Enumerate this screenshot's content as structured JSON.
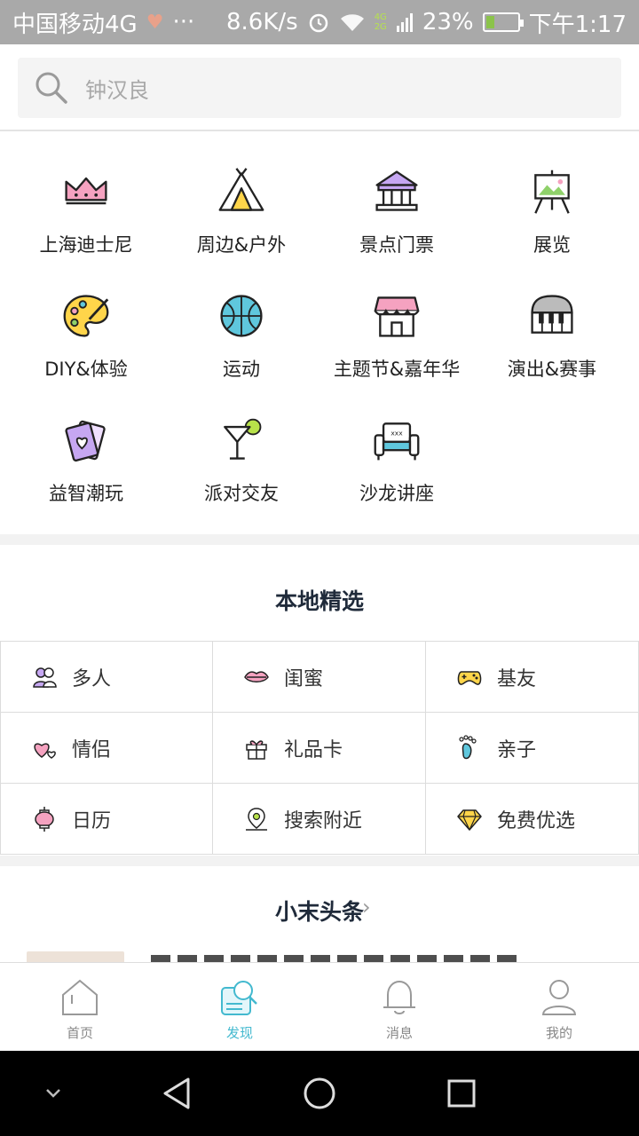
{
  "status_bar": {
    "carrier": "中国移动4G",
    "dots": "···",
    "speed": "8.6K/s",
    "net_4g": "4G",
    "net_2g": "2G",
    "battery_pct": "23%",
    "time": "下午1:17",
    "battery_level": 0.23
  },
  "search": {
    "placeholder": "钟汉良"
  },
  "categories": [
    {
      "label": "上海迪士尼",
      "icon": "crown-icon"
    },
    {
      "label": "周边&户外",
      "icon": "tent-icon"
    },
    {
      "label": "景点门票",
      "icon": "temple-icon"
    },
    {
      "label": "展览",
      "icon": "easel-icon"
    },
    {
      "label": "DIY&体验",
      "icon": "palette-icon"
    },
    {
      "label": "运动",
      "icon": "ball-icon"
    },
    {
      "label": "主题节&嘉年华",
      "icon": "stall-icon"
    },
    {
      "label": "演出&赛事",
      "icon": "piano-icon"
    },
    {
      "label": "益智潮玩",
      "icon": "cards-icon"
    },
    {
      "label": "派对交友",
      "icon": "cocktail-icon"
    },
    {
      "label": "沙龙讲座",
      "icon": "sofa-icon"
    }
  ],
  "local": {
    "title": "本地精选",
    "items": [
      {
        "label": "多人",
        "icon": "people-icon"
      },
      {
        "label": "闺蜜",
        "icon": "lips-icon"
      },
      {
        "label": "基友",
        "icon": "gamepad-icon"
      },
      {
        "label": "情侣",
        "icon": "hearts-icon"
      },
      {
        "label": "礼品卡",
        "icon": "gift-icon"
      },
      {
        "label": "亲子",
        "icon": "footprint-icon"
      },
      {
        "label": "日历",
        "icon": "lantern-icon"
      },
      {
        "label": "搜索附近",
        "icon": "location-icon"
      },
      {
        "label": "免费优选",
        "icon": "diamond-icon"
      }
    ]
  },
  "headlines": {
    "title": "小末头条",
    "chevron": "›"
  },
  "tabs": [
    {
      "label": "首页",
      "icon": "home-icon"
    },
    {
      "label": "发现",
      "icon": "discover-icon",
      "active": true
    },
    {
      "label": "消息",
      "icon": "bell-icon"
    },
    {
      "label": "我的",
      "icon": "user-icon"
    }
  ],
  "colors": {
    "accent": "#43b9cf",
    "pink": "#f5a2c0",
    "yellow": "#ffd54a",
    "purple": "#c6a7f2",
    "blue": "#5fc7dd"
  }
}
